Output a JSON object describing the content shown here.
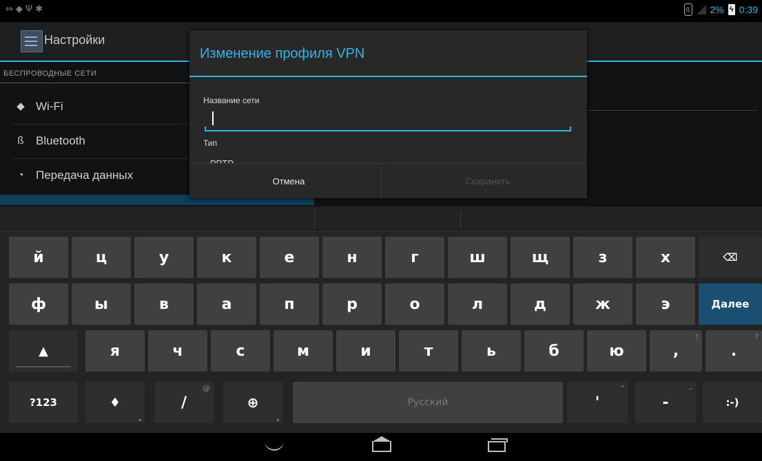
{
  "status_bar": {
    "left_icons": [
      "usb-icon",
      "wifi-icon",
      "usb-debug-icon",
      "android-icon"
    ],
    "bluetooth_icon": "bluetooth-icon",
    "signal_icon": "no-signal-icon",
    "battery_percent": "2%",
    "battery_icon": "battery-charging-icon",
    "time": "0:39"
  },
  "settings": {
    "title": "Настройки",
    "category": "БЕСПРОВОДНЫЕ СЕТИ",
    "items": [
      {
        "icon": "wifi-icon",
        "label": "Wi-Fi"
      },
      {
        "icon": "bluetooth-icon",
        "label": "Bluetooth"
      },
      {
        "icon": "data-usage-icon",
        "label": "Передача данных"
      }
    ]
  },
  "dialog": {
    "title": "Изменение профиля VPN",
    "network_name_label": "Название сети",
    "network_name_value": "",
    "type_label": "Тип",
    "type_value": "PPTP",
    "cancel_label": "Отмена",
    "save_label": "Сохранить"
  },
  "keyboard": {
    "row1": [
      "й",
      "ц",
      "у",
      "к",
      "е",
      "н",
      "г",
      "ш",
      "щ",
      "з",
      "х"
    ],
    "row2": [
      "ф",
      "ы",
      "в",
      "а",
      "п",
      "р",
      "о",
      "л",
      "д",
      "ж",
      "э"
    ],
    "next_label": "Далее",
    "row3": [
      "я",
      "ч",
      "с",
      "м",
      "и",
      "т",
      "ь",
      "б",
      "ю"
    ],
    "comma": ",",
    "comma_hint": "!",
    "period": ".",
    "period_hint": "?",
    "symbols_label": "?123",
    "slash": "/",
    "slash_hint": "@",
    "space_label": "Русский",
    "apostrophe": "'",
    "apostrophe_hint": "\"",
    "dash": "-",
    "dash_hint": "–",
    "smiley": ":-)",
    "colors": {
      "accent": "#33b5e5",
      "key": "#3e4042",
      "next_key": "#1a4f72"
    }
  }
}
